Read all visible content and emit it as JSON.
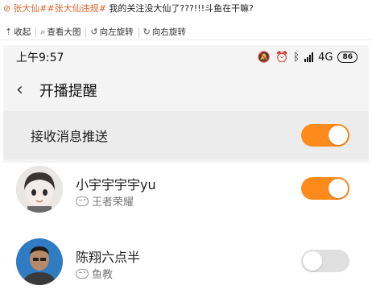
{
  "post": {
    "icon": "warning-icon",
    "tag1": "张大仙#",
    "tag2": "#张大仙违规#",
    "text": " 我的关注没大仙了???!!!斗鱼在干嘛?"
  },
  "toolbar": {
    "collapse": "收起",
    "view_large": "查看大图",
    "rotate_left": "向左旋转",
    "rotate_right": "向右旋转"
  },
  "status_bar": {
    "time": "上午9:57",
    "network": "4G",
    "battery": "86"
  },
  "nav": {
    "back": "‹",
    "title": "开播提醒"
  },
  "receive_push": {
    "label": "接收消息推送",
    "enabled": true
  },
  "streamers": [
    {
      "name": "小宇宇宇宇yu",
      "category": "王者荣耀",
      "enabled": true
    },
    {
      "name": "陈翔六点半",
      "category": "鱼教",
      "enabled": false
    }
  ],
  "colors": {
    "accent": "#ff8a1c",
    "tag": "#e0632b",
    "toggle_off": "#e0e0e0"
  }
}
